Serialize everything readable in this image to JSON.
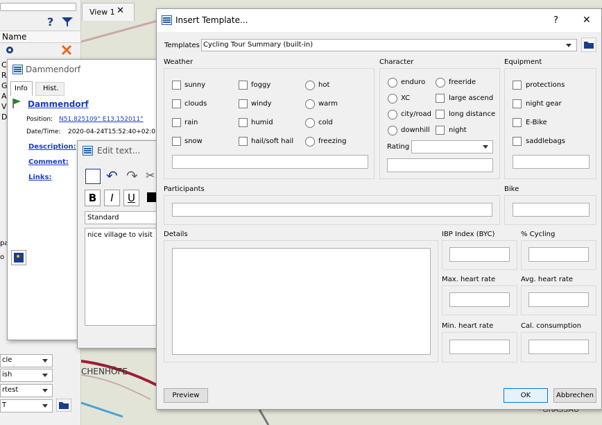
{
  "left_panel": {
    "column_header": "Name",
    "help_label": "?",
    "rows": [
      "C",
      "R",
      "G",
      "A",
      "V",
      "D"
    ],
    "bottom_labels": [
      "pa",
      "o"
    ],
    "combos": [
      "cle",
      "ish",
      "rtest",
      "T"
    ]
  },
  "map": {
    "view_tab_label": "View 1",
    "place_label_1": "CHENHÖFE",
    "place_label_2": "GRASSAU"
  },
  "info_window": {
    "title": "Dammendorf",
    "tabs": [
      "Info",
      "Hist."
    ],
    "name": "Dammendorf",
    "position_label": "Position:",
    "position_value": "N51.825109° E13.152011°",
    "datetime_label": "Date/Time:",
    "datetime_value": "2020-04-24T15:52:40+02:0",
    "links": [
      "Description:",
      "Comment:",
      "Links:"
    ]
  },
  "edit_window": {
    "title": "Edit text...",
    "format_buttons": [
      "B",
      "I",
      "U"
    ],
    "style_value": "Standard",
    "text": "nice village to visit"
  },
  "dialog": {
    "title": "Insert Template...",
    "help": "?",
    "close": "✕",
    "templates_label": "Templates",
    "templates_value": "Cycling Tour Summary (built-in)",
    "weather": {
      "title": "Weather",
      "col1": [
        "sunny",
        "clouds",
        "rain",
        "snow"
      ],
      "col2": [
        "foggy",
        "windy",
        "humid",
        "hail/soft hail"
      ],
      "col3": [
        "hot",
        "warm",
        "cold",
        "freezing"
      ]
    },
    "character": {
      "title": "Character",
      "col1": [
        "enduro",
        "XC",
        "city/road",
        "downhill"
      ],
      "col2": [
        "freeride",
        "large ascend",
        "long distance",
        "night"
      ],
      "rating_label": "Rating"
    },
    "equipment": {
      "title": "Equipment",
      "items": [
        "protections",
        "night gear",
        "E-Bike",
        "saddlebags"
      ]
    },
    "participants_label": "Participants",
    "bike_label": "Bike",
    "details_label": "Details",
    "metrics": [
      "IBP Index (BYC)",
      "% Cycling",
      "Max. heart rate",
      "Avg. heart rate",
      "Min. heart rate",
      "Cal. consumption"
    ],
    "preview_button": "Preview",
    "ok_button": "OK",
    "cancel_button": "Abbrechen"
  }
}
